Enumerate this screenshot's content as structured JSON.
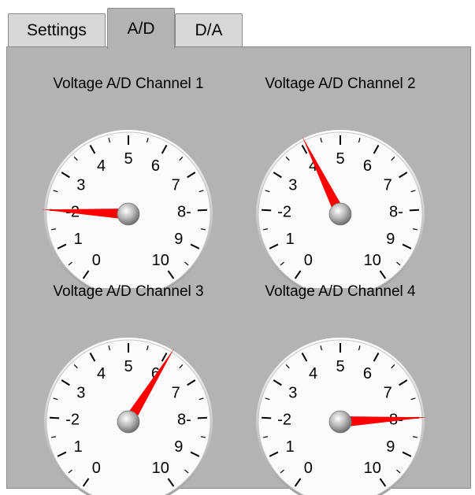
{
  "tabs": [
    {
      "label": "Settings",
      "active": false
    },
    {
      "label": "A/D",
      "active": true
    },
    {
      "label": "D/A",
      "active": false
    }
  ],
  "scale": {
    "labels": [
      "0",
      "1",
      "-2",
      "3",
      "4",
      "5",
      "6",
      "7",
      "8-",
      "9",
      "10"
    ],
    "min": 0,
    "max": 10
  },
  "gauges": [
    {
      "title": "Voltage A/D Channel 1",
      "value": 2.0
    },
    {
      "title": "Voltage A/D Channel 2",
      "value": 4.1
    },
    {
      "title": "Voltage A/D Channel 3",
      "value": 6.1
    },
    {
      "title": "Voltage A/D Channel 4",
      "value": 8.0
    }
  ],
  "colors": {
    "needle": "#ff0000",
    "panel": "#b3b3b3",
    "dial_face": "#fbfbfb"
  }
}
